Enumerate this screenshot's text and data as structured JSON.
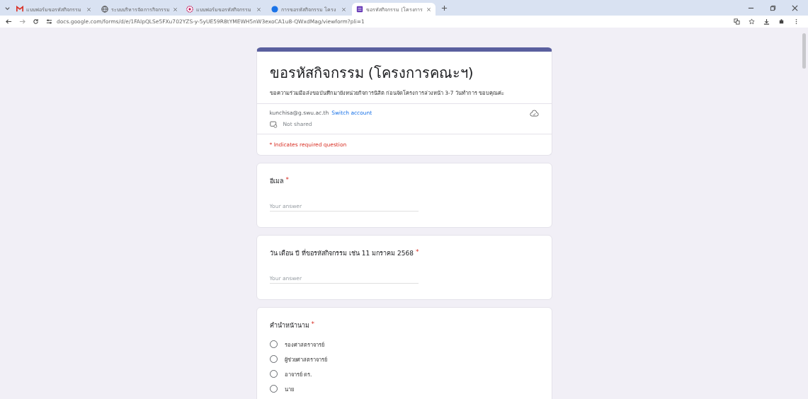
{
  "browser": {
    "tabs": [
      {
        "title": "แบบฟอร์มขอรหัสกิจกรรม",
        "selected": false
      },
      {
        "title": "ระบบบริหารจัดการกิจกรรม",
        "selected": false
      },
      {
        "title": "แบบฟอร์มขอรหัสกิจกรรม",
        "selected": false
      },
      {
        "title": "การขอรหัสกิจกรรม โครง",
        "selected": false
      },
      {
        "title": "ขอรหัสกิจกรรม (โครงการ",
        "selected": true
      }
    ],
    "url": "docs.google.com/forms/d/e/1FAIpQLSe5FXu702YZS-y-5yUE59R8tYMEWH5nW3exoCA1u8-QWxdMag/viewform?pli=1"
  },
  "form": {
    "title": "ขอรหัสกิจกรรม (โครงการคณะฯ)",
    "description": "ขอความร่วมมือส่งขอบันทึกมายังหน่วยกิจการนิสิต ก่อนจัดโครงการล่วงหน้า 3-7 วันทำการ ขอบคุณค่ะ",
    "account": "kunchisa@g.swu.ac.th",
    "switch_account": "Switch account",
    "sharing": "Not shared",
    "required_note": "* Indicates required question",
    "questions": [
      {
        "kind": "text",
        "label": "อีเมล",
        "required_mark": "*",
        "placeholder": "Your answer"
      },
      {
        "kind": "text",
        "label": "วัน เดือน ปี ที่ขอรหัสกิจกรรม เช่น 11 มกราคม 2568",
        "required_mark": "*",
        "placeholder": "Your answer"
      },
      {
        "kind": "choice",
        "label": "คำนำหน้านาม",
        "required_mark": "*",
        "options": [
          {
            "label": "รองศาสตราจารย์",
            "selected": false
          },
          {
            "label": "ผู้ช่วยศาสตราจารย์",
            "selected": false
          },
          {
            "label": "อาจารย์ ดร.",
            "selected": false
          },
          {
            "label": "นาย",
            "selected": false
          }
        ]
      }
    ]
  }
}
